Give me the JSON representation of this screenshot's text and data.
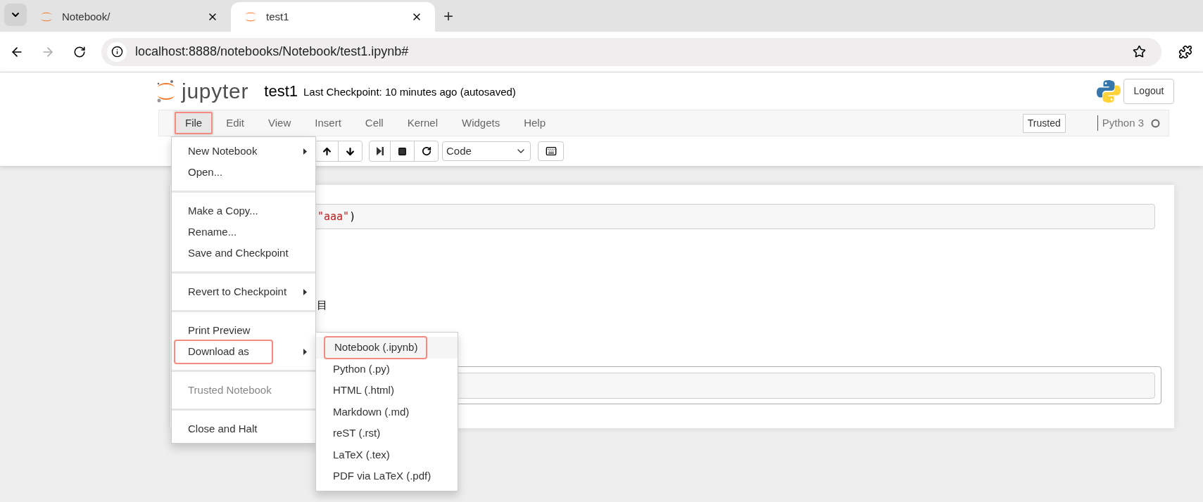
{
  "browser": {
    "tabs": [
      {
        "title": "Notebook/",
        "selected": false
      },
      {
        "title": "test1",
        "selected": true
      }
    ],
    "new_tab": "+",
    "forward_disabled": true,
    "address": "localhost:8888/notebooks/Notebook/test1.ipynb#"
  },
  "header": {
    "logo": "jupyter",
    "notebook_name": "test1",
    "checkpoint": "Last Checkpoint: 10 minutes ago (autosaved)",
    "logout": "Logout"
  },
  "menubar": {
    "items": [
      {
        "label": "File",
        "selected": true
      },
      {
        "label": "Edit",
        "selected": false
      },
      {
        "label": "View",
        "selected": false
      },
      {
        "label": "Insert",
        "selected": false
      },
      {
        "label": "Cell",
        "selected": false
      },
      {
        "label": "Kernel",
        "selected": false
      },
      {
        "label": "Widgets",
        "selected": false
      },
      {
        "label": "Help",
        "selected": false
      }
    ],
    "trusted": "Trusted",
    "kernel": "Python 3"
  },
  "toolbar": {
    "cell_type": "Code"
  },
  "cells": [
    {
      "kind": "code",
      "parts": [
        {
          "kind": "string",
          "text": "\"aaa\""
        },
        {
          "kind": "plain",
          "text": ")"
        }
      ]
    },
    {
      "kind": "output",
      "text": "目"
    },
    {
      "kind": "empty"
    }
  ],
  "file_menu": {
    "items": [
      {
        "kind": "item",
        "label": "New Notebook",
        "submenu": true,
        "disabled": false,
        "highlighted": false
      },
      {
        "kind": "item",
        "label": "Open...",
        "submenu": false,
        "disabled": false,
        "highlighted": false
      },
      {
        "kind": "divider"
      },
      {
        "kind": "item",
        "label": "Make a Copy...",
        "submenu": false,
        "disabled": false,
        "highlighted": false
      },
      {
        "kind": "item",
        "label": "Rename...",
        "submenu": false,
        "disabled": false,
        "highlighted": false
      },
      {
        "kind": "item",
        "label": "Save and Checkpoint",
        "submenu": false,
        "disabled": false,
        "highlighted": false
      },
      {
        "kind": "divider"
      },
      {
        "kind": "item",
        "label": "Revert to Checkpoint",
        "submenu": true,
        "disabled": false,
        "highlighted": false
      },
      {
        "kind": "divider"
      },
      {
        "kind": "item",
        "label": "Print Preview",
        "submenu": false,
        "disabled": false,
        "highlighted": false
      },
      {
        "kind": "item",
        "label": "Download as",
        "submenu": true,
        "disabled": false,
        "highlighted": true
      },
      {
        "kind": "divider"
      },
      {
        "kind": "item",
        "label": "Trusted Notebook",
        "submenu": false,
        "disabled": true,
        "highlighted": false
      },
      {
        "kind": "divider"
      },
      {
        "kind": "item",
        "label": "Close and Halt",
        "submenu": false,
        "disabled": false,
        "highlighted": false
      }
    ]
  },
  "download_menu": {
    "items": [
      {
        "label": "Notebook (.ipynb)",
        "highlighted": true
      },
      {
        "label": "Python (.py)",
        "highlighted": false
      },
      {
        "label": "HTML (.html)",
        "highlighted": false
      },
      {
        "label": "Markdown (.md)",
        "highlighted": false
      },
      {
        "label": "reST (.rst)",
        "highlighted": false
      },
      {
        "label": "LaTeX (.tex)",
        "highlighted": false
      },
      {
        "label": "PDF via LaTeX (.pdf)",
        "highlighted": false
      }
    ]
  }
}
